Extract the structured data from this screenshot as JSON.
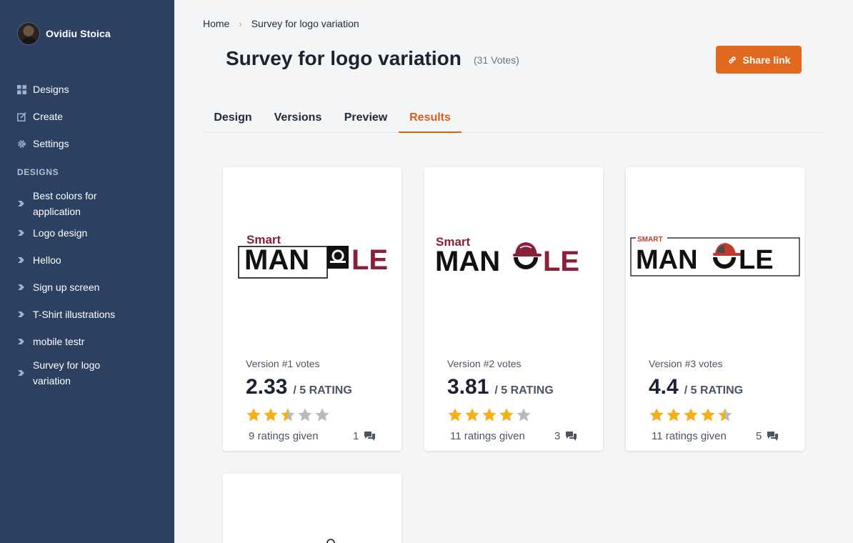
{
  "user": {
    "name": "Ovidiu Stoica"
  },
  "nav": [
    {
      "label": "Designs",
      "icon": "grid-icon"
    },
    {
      "label": "Create",
      "icon": "edit-icon"
    },
    {
      "label": "Settings",
      "icon": "gear-icon"
    }
  ],
  "designs_section": {
    "title": "DESIGNS",
    "items": [
      {
        "label": "Best colors for application"
      },
      {
        "label": "Logo design"
      },
      {
        "label": "Helloo"
      },
      {
        "label": "Sign up screen"
      },
      {
        "label": "T-Shirt illustrations"
      },
      {
        "label": "mobile testr"
      },
      {
        "label": "Survey for logo variation"
      }
    ]
  },
  "breadcrumb": {
    "home": "Home",
    "current": "Survey for logo variation"
  },
  "page": {
    "title": "Survey for logo variation",
    "votes": "(31 Votes)",
    "share_label": "Share link"
  },
  "tabs": [
    {
      "label": "Design"
    },
    {
      "label": "Versions"
    },
    {
      "label": "Preview"
    },
    {
      "label": "Results",
      "active": true
    }
  ],
  "colors": {
    "accent": "#e0681f",
    "sidebar": "#2c4162",
    "star": "#f5b014",
    "star_empty": "#b7babe",
    "logo_red": "#8b1f3a"
  },
  "logo": {
    "small": "Smart",
    "small_caps": "SMART",
    "main_left": "MAN",
    "main_right": "LE"
  },
  "results": [
    {
      "version_label": "Version #1 votes",
      "rating": "2.33",
      "rating_suffix": "/ 5 RATING",
      "rating_value": 2.33,
      "given": "9 ratings given",
      "comments": "1"
    },
    {
      "version_label": "Version #2 votes",
      "rating": "3.81",
      "rating_suffix": "/ 5 RATING",
      "rating_value": 3.81,
      "given": "11 ratings given",
      "comments": "3"
    },
    {
      "version_label": "Version #3 votes",
      "rating": "4.4",
      "rating_suffix": "/ 5 RATING",
      "rating_value": 4.4,
      "given": "11 ratings given",
      "comments": "5"
    }
  ]
}
